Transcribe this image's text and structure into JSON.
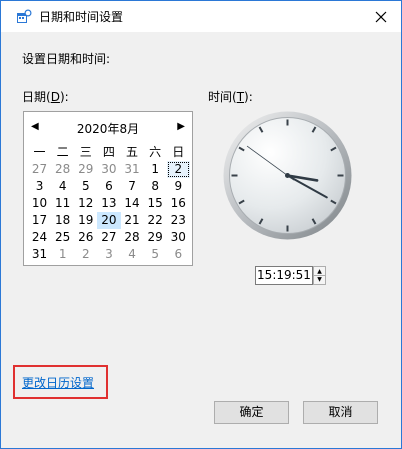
{
  "window": {
    "title": "日期和时间设置"
  },
  "heading": "设置日期和时间:",
  "date_label": {
    "pre": "日期(",
    "key": "D",
    "post": "):"
  },
  "time_label": {
    "pre": "时间(",
    "key": "T",
    "post": "):"
  },
  "calendar": {
    "title": "2020年8月",
    "weekdays": [
      "一",
      "二",
      "三",
      "四",
      "五",
      "六",
      "日"
    ],
    "weeks": [
      [
        "27",
        "28",
        "29",
        "30",
        "31",
        "1",
        "2"
      ],
      [
        "3",
        "4",
        "5",
        "6",
        "7",
        "8",
        "9"
      ],
      [
        "10",
        "11",
        "12",
        "13",
        "14",
        "15",
        "16"
      ],
      [
        "17",
        "18",
        "19",
        "20",
        "21",
        "22",
        "23"
      ],
      [
        "24",
        "25",
        "26",
        "27",
        "28",
        "29",
        "30"
      ],
      [
        "31",
        "1",
        "2",
        "3",
        "4",
        "5",
        "6"
      ]
    ],
    "selected_day": "2",
    "today": "20"
  },
  "clock": {
    "hour": 15,
    "minute": 19,
    "second": 51
  },
  "time_value": "15:19:51",
  "change_calendar_link": "更改日历设置",
  "ok_label": "确定",
  "cancel_label": "取消",
  "accent_color": "#2b78d6",
  "highlight_color": "#e03030"
}
